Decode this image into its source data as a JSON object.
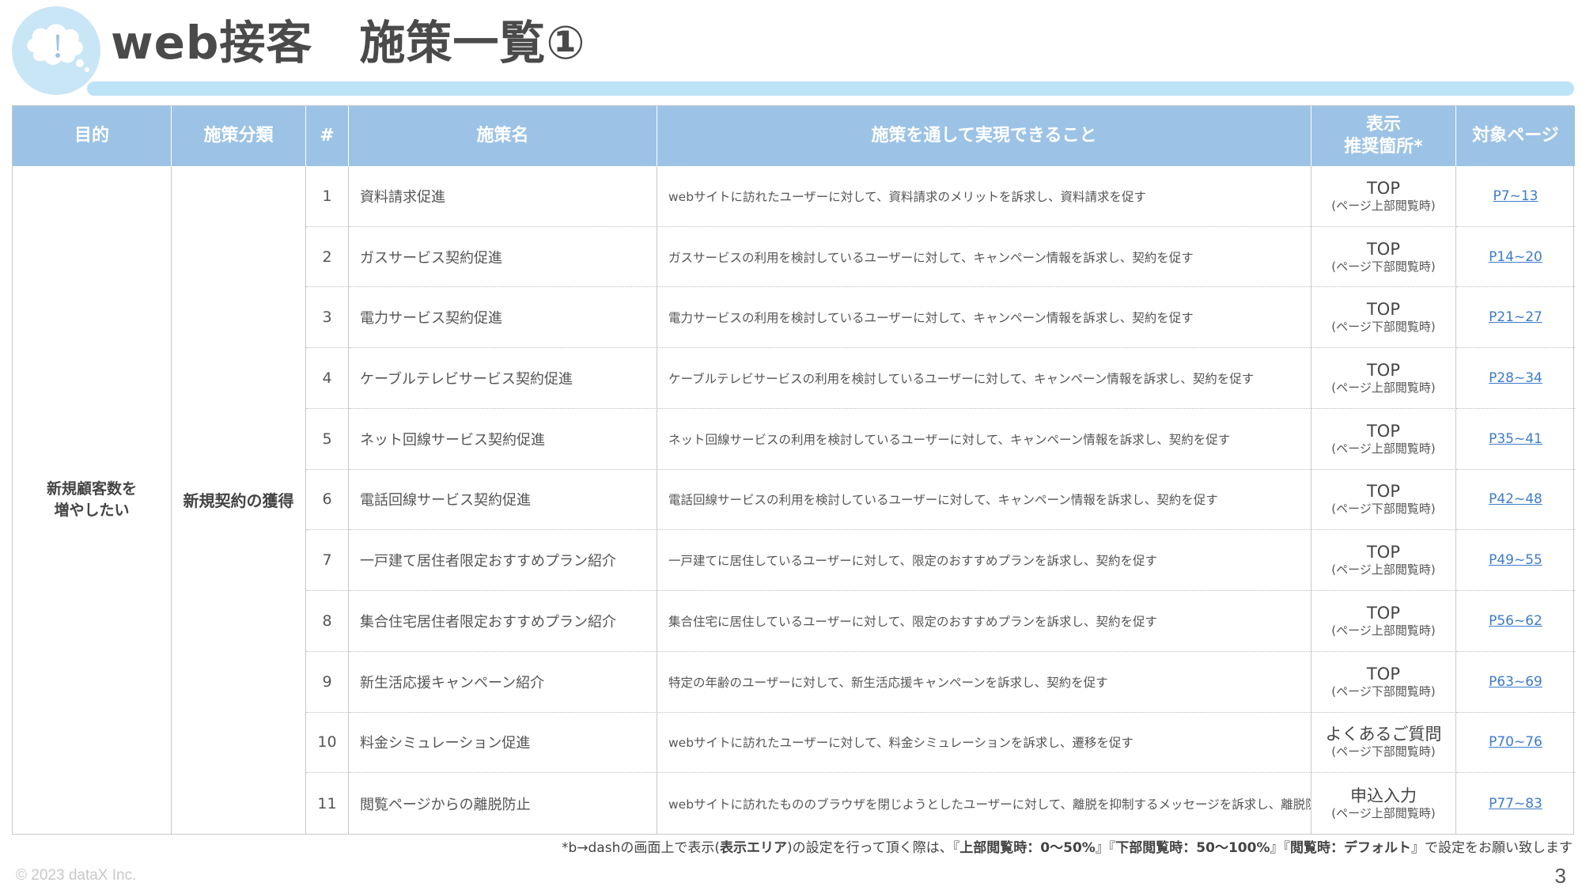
{
  "header": {
    "title": "web接客　施策一覧①"
  },
  "table": {
    "headers": [
      "目的",
      "施策分類",
      "#",
      "施策名",
      "施策を通して実現できること",
      "表示\n推奨箇所*",
      "対象ページ"
    ],
    "purpose": "新規顧客数を\n増やしたい",
    "category": "新規契約の獲得",
    "rows": [
      {
        "num": "1",
        "name": "資料請求促進",
        "desc": "webサイトに訪れたユーザーに対して、資料請求のメリットを訴求し、資料請求を促す",
        "disp_main": "TOP",
        "disp_sub": "(ページ上部閲覧時)",
        "page": "P7~13"
      },
      {
        "num": "2",
        "name": "ガスサービス契約促進",
        "desc": "ガスサービスの利用を検討しているユーザーに対して、キャンペーン情報を訴求し、契約を促す",
        "disp_main": "TOP",
        "disp_sub": "(ページ下部閲覧時)",
        "page": "P14~20"
      },
      {
        "num": "3",
        "name": "電力サービス契約促進",
        "desc": "電力サービスの利用を検討しているユーザーに対して、キャンペーン情報を訴求し、契約を促す",
        "disp_main": "TOP",
        "disp_sub": "(ページ下部閲覧時)",
        "page": "P21~27"
      },
      {
        "num": "4",
        "name": "ケーブルテレビサービス契約促進",
        "desc": "ケーブルテレビサービスの利用を検討しているユーザーに対して、キャンペーン情報を訴求し、契約を促す",
        "disp_main": "TOP",
        "disp_sub": "(ページ上部閲覧時)",
        "page": "P28~34"
      },
      {
        "num": "5",
        "name": "ネット回線サービス契約促進",
        "desc": "ネット回線サービスの利用を検討しているユーザーに対して、キャンペーン情報を訴求し、契約を促す",
        "disp_main": "TOP",
        "disp_sub": "(ページ上部閲覧時)",
        "page": "P35~41"
      },
      {
        "num": "6",
        "name": "電話回線サービス契約促進",
        "desc": "電話回線サービスの利用を検討しているユーザーに対して、キャンペーン情報を訴求し、契約を促す",
        "disp_main": "TOP",
        "disp_sub": "(ページ下部閲覧時)",
        "page": "P42~48"
      },
      {
        "num": "7",
        "name": "一戸建て居住者限定おすすめプラン紹介",
        "desc": "一戸建てに居住しているユーザーに対して、限定のおすすめプランを訴求し、契約を促す",
        "disp_main": "TOP",
        "disp_sub": "(ページ上部閲覧時)",
        "page": "P49~55"
      },
      {
        "num": "8",
        "name": "集合住宅居住者限定おすすめプラン紹介",
        "desc": "集合住宅に居住しているユーザーに対して、限定のおすすめプランを訴求し、契約を促す",
        "disp_main": "TOP",
        "disp_sub": "(ページ上部閲覧時)",
        "page": "P56~62"
      },
      {
        "num": "9",
        "name": "新生活応援キャンペーン紹介",
        "desc": "特定の年齢のユーザーに対して、新生活応援キャンペーンを訴求し、契約を促す",
        "disp_main": "TOP",
        "disp_sub": "(ページ下部閲覧時)",
        "page": "P63~69"
      },
      {
        "num": "10",
        "name": "料金シミュレーション促進",
        "desc": "webサイトに訪れたユーザーに対して、料金シミュレーションを訴求し、遷移を促す",
        "disp_main": "よくあるご質問",
        "disp_sub": "(ページ下部閲覧時)",
        "page": "P70~76"
      },
      {
        "num": "11",
        "name": "閲覧ページからの離脱防止",
        "desc": "webサイトに訪れたもののブラウザを閉じようとしたユーザーに対して、離脱を抑制するメッセージを訴求し、離脱防止を促す",
        "disp_main": "申込入力",
        "disp_sub": "(ページ上部閲覧時)",
        "page": "P77~83"
      }
    ]
  },
  "footnote": {
    "p1": "*b→dashの画面上で表示(",
    "b1": "表示エリア",
    "p2": ")の設定を行って頂く際は、『",
    "b2": "上部閲覧時：0～50%",
    "p3": "』『",
    "b3": "下部閲覧時：50～100%",
    "p4": "』『",
    "b4": "閲覧時：デフォルト",
    "p5": "』で設定をお願い致します"
  },
  "footer": {
    "copyright": "© 2023 dataX Inc.",
    "page_number": "3"
  },
  "colors": {
    "header_bg": "#9cc3e6",
    "accent_light": "#bde3f7",
    "link": "#3d7bc9"
  }
}
